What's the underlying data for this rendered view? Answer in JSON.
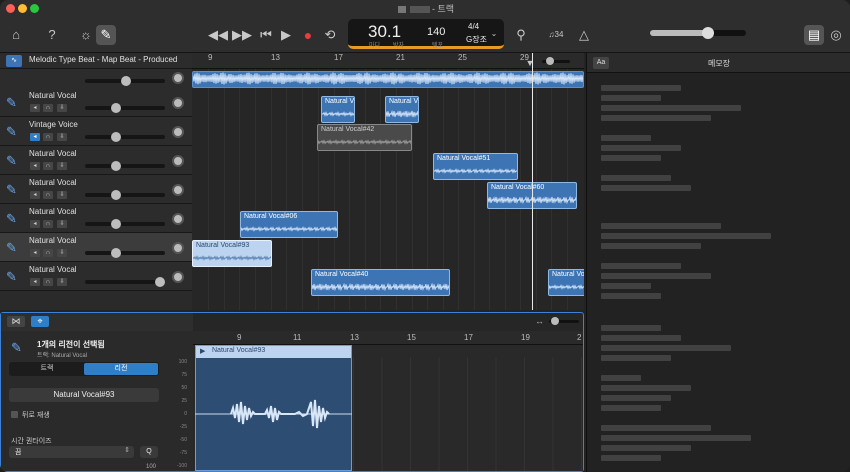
{
  "window": {
    "title_suffix": "- 트랙"
  },
  "lcd": {
    "position": "30.1",
    "bar_label": "마디",
    "beat_label": "박자",
    "tempo": "140",
    "tempo_label": "템포",
    "signature": "4/4",
    "key": "G장조"
  },
  "toolbar": {
    "count_in": "♫34"
  },
  "ruler": {
    "marks": [
      "9",
      "13",
      "17",
      "21",
      "25",
      "29"
    ]
  },
  "tracks": [
    {
      "name": "Melodic Type Beat - Map Beat - Produced",
      "icon": "waveform-icon"
    },
    {
      "name": "Natural Vocal",
      "icon": "mic-icon"
    },
    {
      "name": "Vintage Voice",
      "icon": "mic-icon"
    },
    {
      "name": "Natural Vocal",
      "icon": "mic-icon"
    },
    {
      "name": "Natural Vocal",
      "icon": "mic-icon"
    },
    {
      "name": "Natural Vocal",
      "icon": "mic-icon"
    },
    {
      "name": "Natural Vocal",
      "icon": "mic-icon"
    },
    {
      "name": "Natural Vocal",
      "icon": "mic-icon"
    }
  ],
  "regions": [
    {
      "label": "Natural V",
      "lane": 1
    },
    {
      "label": "Natural Vo",
      "lane": 1
    },
    {
      "label": "Natural Vocal#42",
      "lane": 2
    },
    {
      "label": "Natural Vocal#51",
      "lane": 3
    },
    {
      "label": "Natural Vocal#60",
      "lane": 4
    },
    {
      "label": "Natural Vocal#06",
      "lane": 5
    },
    {
      "label": "Natural Vocal#93",
      "lane": 6
    },
    {
      "label": "Natural Vocal#40",
      "lane": 7
    },
    {
      "label": "Natural Vo",
      "lane": 7
    }
  ],
  "notes": {
    "title": "메모장",
    "font_button": "Aa"
  },
  "editor": {
    "selection_title": "1개의 리전이 선택됨",
    "selection_sub": "트랙: Natural Vocal",
    "tab_track": "트랙",
    "tab_region": "리전",
    "region_name": "Natural Vocal#93",
    "reverse_label": "뒤로 재생",
    "quantize_label": "시간 퀀타이즈",
    "quantize_value": "끔",
    "quantize_button": "Q",
    "gain_value": "100",
    "ruler_marks": [
      "9",
      "11",
      "13",
      "15",
      "17",
      "19",
      "2"
    ],
    "region_label": "Natural Vocal#93",
    "amp_labels": [
      "100",
      "75",
      "50",
      "25",
      "0",
      "-25",
      "-50",
      "-75",
      "-100"
    ]
  }
}
